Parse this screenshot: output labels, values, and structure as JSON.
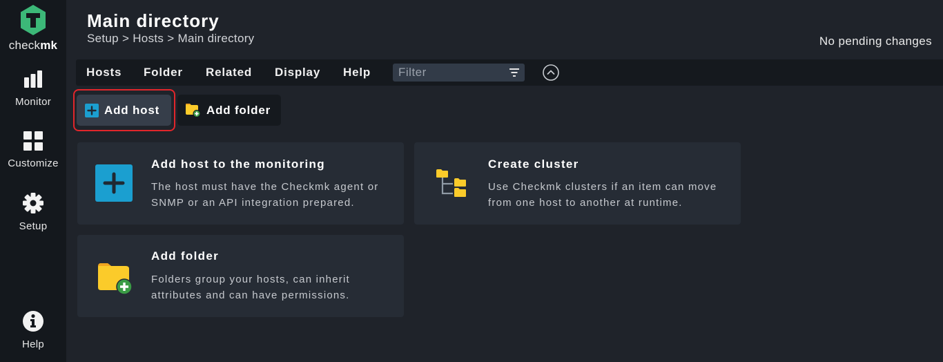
{
  "sidebar": {
    "logo": {
      "text_prefix": "check",
      "text_suffix": "mk",
      "icon": "checkmk-logo-icon"
    },
    "items": [
      {
        "label": "Monitor",
        "icon": "bar-chart-icon"
      },
      {
        "label": "Customize",
        "icon": "grid-icon"
      },
      {
        "label": "Setup",
        "icon": "gear-icon"
      },
      {
        "label": "Help",
        "icon": "info-icon"
      }
    ]
  },
  "header": {
    "title": "Main directory",
    "breadcrumb": [
      "Setup",
      "Hosts",
      "Main directory"
    ],
    "breadcrumb_separator": ">",
    "pending_changes": "No pending changes"
  },
  "menubar": {
    "items": [
      "Hosts",
      "Folder",
      "Related",
      "Display",
      "Help"
    ],
    "filter": {
      "placeholder": "Filter",
      "value": "",
      "icon": "filter-icon"
    },
    "collapse_icon": "chevron-up-circle-icon"
  },
  "actions": {
    "add_host": {
      "label": "Add host",
      "icon": "plus-square-icon",
      "highlighted": true
    },
    "add_folder": {
      "label": "Add folder",
      "icon": "folder-add-icon"
    }
  },
  "cards": [
    {
      "title": "Add host to the monitoring",
      "desc_line1": "The host must have the Checkmk agent or",
      "desc_line2": "SNMP or an API integration prepared.",
      "icon": "plus-square-icon"
    },
    {
      "title": "Create cluster",
      "desc_line1": "Use Checkmk clusters if an item can move",
      "desc_line2": "from one host to another at runtime.",
      "icon": "folder-tree-icon"
    },
    {
      "title": "Add folder",
      "desc_line1": "Folders group your hosts, can inherit",
      "desc_line2": "attributes and can have permissions.",
      "icon": "folder-add-icon"
    }
  ],
  "colors": {
    "brand_green": "#3cb878",
    "accent_blue": "#1b9fd0",
    "folder_yellow": "#fbcb2a",
    "highlight_red": "#e1262b",
    "add_green": "#3a9c45"
  }
}
